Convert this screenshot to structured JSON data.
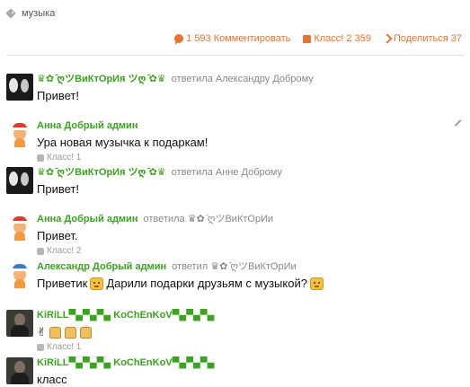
{
  "tag": {
    "label": "музыка",
    "icon": "tag-icon"
  },
  "actions": {
    "comments": {
      "icon": "comment-icon",
      "label": "1 593 Комментировать"
    },
    "class": {
      "icon": "thumbs-up-icon",
      "label": "Класс! 2 359"
    },
    "share": {
      "icon": "share-icon",
      "label": "Поделиться 37"
    }
  },
  "colors": {
    "accent": "#eb722e",
    "author": "#3aa31f",
    "muted": "#888888"
  },
  "comments": [
    {
      "author": "♛✿ ̄ღツВиКтОрИя ツღ ̄✿♛",
      "reply": "ответила Александру Доброму",
      "text": "Привет!",
      "likes": ""
    },
    {
      "author": "Анна Добрый админ",
      "reply": "",
      "text": "Ура новая музычка к подаркам!",
      "likes": "Класс! 1"
    },
    {
      "author": "♛✿ ̄ღツВиКтОрИя ツღ ̄✿♛",
      "reply": "ответила Анне Доброму",
      "text": "Привет!",
      "likes": ""
    },
    {
      "author": "Анна Добрый админ",
      "reply": "ответила ♛✿ ̄ღツВиКтОрИи",
      "text": "Привет.",
      "likes": "Класс! 2"
    },
    {
      "author": "Александр Добрый админ",
      "reply": "ответил ♛✿ ̄ღツВиКтОрИи",
      "text_before": "Приветик",
      "text_middle": "Дарили подарки друзьям с музыкой?",
      "likes": ""
    },
    {
      "author": "KiRiLL▀▄▀▄▀▄ KoChEnKoV▀▄▀▄▀▄",
      "reply": "",
      "text": "✌",
      "likes": "Класс! 1"
    },
    {
      "author": "KiRiLL▀▄▀▄▀▄ KoChEnKoV▀▄▀▄▀▄",
      "reply": "",
      "text": "класс",
      "likes": ""
    }
  ]
}
